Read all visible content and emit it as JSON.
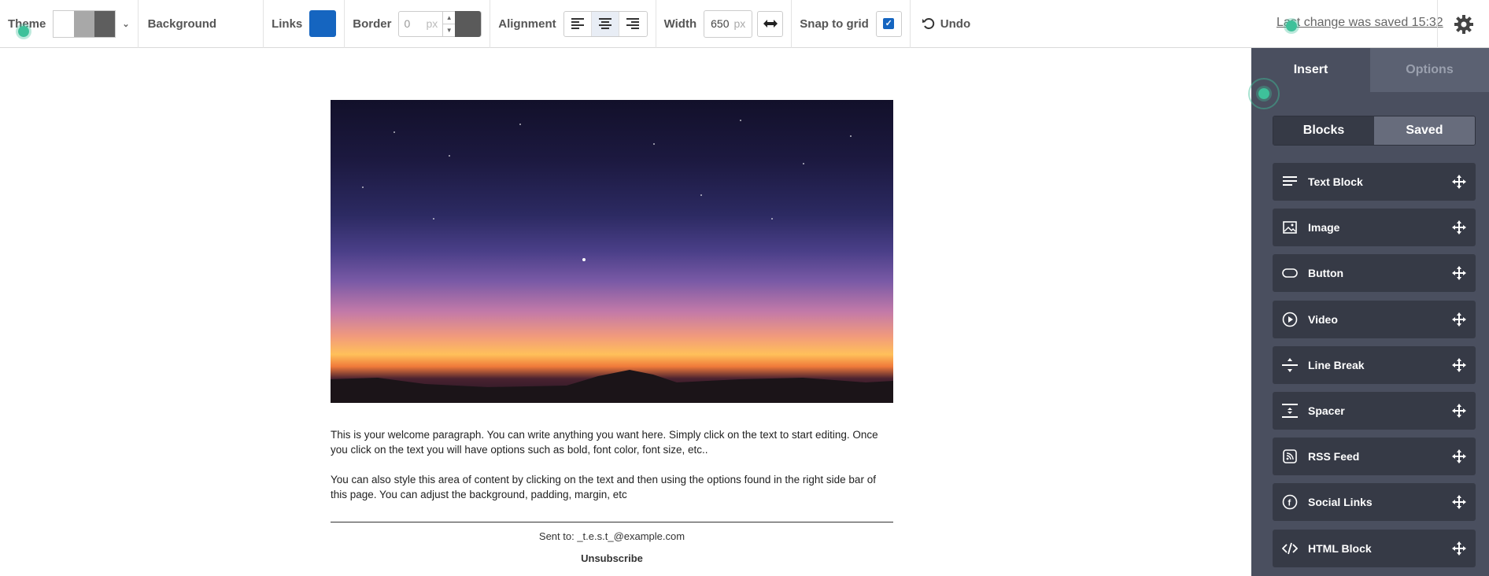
{
  "toolbar": {
    "theme_label": "Theme",
    "theme_swatches": [
      "#ffffff",
      "#a8a8a8",
      "#5e5e5e"
    ],
    "background_label": "Background",
    "links_label": "Links",
    "links_color": "#1565c0",
    "border_label": "Border",
    "border_value": "0",
    "border_unit": "px",
    "border_color": "#5a5a5a",
    "alignment_label": "Alignment",
    "alignment_selected": "center",
    "width_label": "Width",
    "width_value": "650",
    "width_unit": "px",
    "snap_label": "Snap to grid",
    "snap_checked": true,
    "undo_label": "Undo",
    "saved_text": "Last change was saved 15:32"
  },
  "canvas": {
    "paragraph1": "This is your welcome paragraph. You can write anything you want here. Simply click on the text to start editing. Once you click on the text you will have options such as bold, font color, font size, etc..",
    "paragraph2": "You can also style this area of content by clicking on the text and then using the options found in the right side bar of this page. You can adjust the background, padding, margin, etc",
    "sent_to": "Sent to: _t.e.s.t_@example.com",
    "unsubscribe": "Unsubscribe"
  },
  "sidebar": {
    "tabs": [
      {
        "label": "Insert",
        "active": true
      },
      {
        "label": "Options",
        "active": false
      }
    ],
    "segments": [
      {
        "label": "Blocks",
        "active": true
      },
      {
        "label": "Saved",
        "active": false
      }
    ],
    "blocks": [
      {
        "label": "Text Block",
        "icon": "text-lines-icon"
      },
      {
        "label": "Image",
        "icon": "image-icon"
      },
      {
        "label": "Button",
        "icon": "button-pill-icon"
      },
      {
        "label": "Video",
        "icon": "play-circle-icon"
      },
      {
        "label": "Line Break",
        "icon": "line-break-icon"
      },
      {
        "label": "Spacer",
        "icon": "spacer-icon"
      },
      {
        "label": "RSS Feed",
        "icon": "rss-icon"
      },
      {
        "label": "Social Links",
        "icon": "facebook-icon"
      },
      {
        "label": "HTML Block",
        "icon": "code-icon"
      }
    ]
  }
}
